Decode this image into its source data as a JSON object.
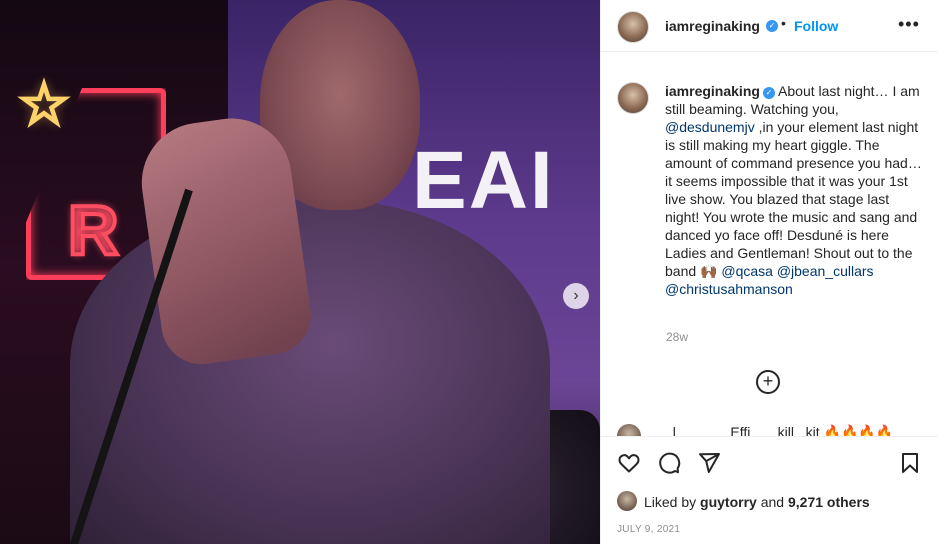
{
  "photo": {
    "wall_text": "EAI\nU",
    "sign_letter": "R",
    "next_glyph": "›",
    "star_glyph": "☆"
  },
  "post": {
    "username": "iamreginaking",
    "verified_glyph": "✓",
    "separator": "•",
    "follow_label": "Follow",
    "more_glyph": "•••",
    "caption_parts": {
      "p1": "About last night… I am still beaming. Watching you, ",
      "m1": "@desdunemjv",
      "p2": " ,in your element last night is still making my heart giggle. The amount of command presence you had…it seems impossible that it was your 1st live show. You blazed that stage last night! You wrote the music and sang and danced yo face off! Desduné is here Ladies and Gentleman! Shout out to the band 🙌🏾 ",
      "m2": "@qcasa",
      "p3": " ",
      "m3": "@jbean_cullars",
      "p4": " ",
      "m4": "@christusahmanson"
    },
    "age": "28w",
    "load_more_glyph": "+",
    "partial_comment": "_l____ __ Effi___ kill_ kit 🔥🔥🔥🔥",
    "likes": {
      "prefix": "Liked by ",
      "user": "guytorry",
      "middle": " and ",
      "count": "9,271 others"
    },
    "date": "JULY 9, 2021"
  },
  "colors": {
    "link": "#00376b",
    "follow": "#0095f6",
    "verified": "#3897f0",
    "muted": "#8e8e8e"
  },
  "icons": [
    "heart-icon",
    "comment-icon",
    "share-icon",
    "bookmark-icon",
    "add-comment-icon",
    "more-icon",
    "chevron-right-icon"
  ]
}
